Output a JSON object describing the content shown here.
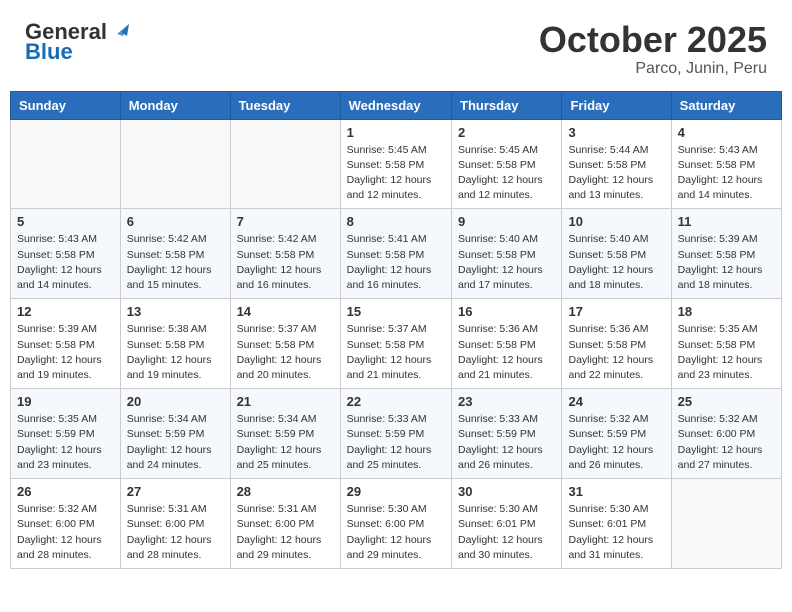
{
  "header": {
    "logo_line1": "General",
    "logo_line2": "Blue",
    "month": "October 2025",
    "location": "Parco, Junin, Peru"
  },
  "weekdays": [
    "Sunday",
    "Monday",
    "Tuesday",
    "Wednesday",
    "Thursday",
    "Friday",
    "Saturday"
  ],
  "weeks": [
    [
      {
        "day": "",
        "info": ""
      },
      {
        "day": "",
        "info": ""
      },
      {
        "day": "",
        "info": ""
      },
      {
        "day": "1",
        "info": "Sunrise: 5:45 AM\nSunset: 5:58 PM\nDaylight: 12 hours\nand 12 minutes."
      },
      {
        "day": "2",
        "info": "Sunrise: 5:45 AM\nSunset: 5:58 PM\nDaylight: 12 hours\nand 12 minutes."
      },
      {
        "day": "3",
        "info": "Sunrise: 5:44 AM\nSunset: 5:58 PM\nDaylight: 12 hours\nand 13 minutes."
      },
      {
        "day": "4",
        "info": "Sunrise: 5:43 AM\nSunset: 5:58 PM\nDaylight: 12 hours\nand 14 minutes."
      }
    ],
    [
      {
        "day": "5",
        "info": "Sunrise: 5:43 AM\nSunset: 5:58 PM\nDaylight: 12 hours\nand 14 minutes."
      },
      {
        "day": "6",
        "info": "Sunrise: 5:42 AM\nSunset: 5:58 PM\nDaylight: 12 hours\nand 15 minutes."
      },
      {
        "day": "7",
        "info": "Sunrise: 5:42 AM\nSunset: 5:58 PM\nDaylight: 12 hours\nand 16 minutes."
      },
      {
        "day": "8",
        "info": "Sunrise: 5:41 AM\nSunset: 5:58 PM\nDaylight: 12 hours\nand 16 minutes."
      },
      {
        "day": "9",
        "info": "Sunrise: 5:40 AM\nSunset: 5:58 PM\nDaylight: 12 hours\nand 17 minutes."
      },
      {
        "day": "10",
        "info": "Sunrise: 5:40 AM\nSunset: 5:58 PM\nDaylight: 12 hours\nand 18 minutes."
      },
      {
        "day": "11",
        "info": "Sunrise: 5:39 AM\nSunset: 5:58 PM\nDaylight: 12 hours\nand 18 minutes."
      }
    ],
    [
      {
        "day": "12",
        "info": "Sunrise: 5:39 AM\nSunset: 5:58 PM\nDaylight: 12 hours\nand 19 minutes."
      },
      {
        "day": "13",
        "info": "Sunrise: 5:38 AM\nSunset: 5:58 PM\nDaylight: 12 hours\nand 19 minutes."
      },
      {
        "day": "14",
        "info": "Sunrise: 5:37 AM\nSunset: 5:58 PM\nDaylight: 12 hours\nand 20 minutes."
      },
      {
        "day": "15",
        "info": "Sunrise: 5:37 AM\nSunset: 5:58 PM\nDaylight: 12 hours\nand 21 minutes."
      },
      {
        "day": "16",
        "info": "Sunrise: 5:36 AM\nSunset: 5:58 PM\nDaylight: 12 hours\nand 21 minutes."
      },
      {
        "day": "17",
        "info": "Sunrise: 5:36 AM\nSunset: 5:58 PM\nDaylight: 12 hours\nand 22 minutes."
      },
      {
        "day": "18",
        "info": "Sunrise: 5:35 AM\nSunset: 5:58 PM\nDaylight: 12 hours\nand 23 minutes."
      }
    ],
    [
      {
        "day": "19",
        "info": "Sunrise: 5:35 AM\nSunset: 5:59 PM\nDaylight: 12 hours\nand 23 minutes."
      },
      {
        "day": "20",
        "info": "Sunrise: 5:34 AM\nSunset: 5:59 PM\nDaylight: 12 hours\nand 24 minutes."
      },
      {
        "day": "21",
        "info": "Sunrise: 5:34 AM\nSunset: 5:59 PM\nDaylight: 12 hours\nand 25 minutes."
      },
      {
        "day": "22",
        "info": "Sunrise: 5:33 AM\nSunset: 5:59 PM\nDaylight: 12 hours\nand 25 minutes."
      },
      {
        "day": "23",
        "info": "Sunrise: 5:33 AM\nSunset: 5:59 PM\nDaylight: 12 hours\nand 26 minutes."
      },
      {
        "day": "24",
        "info": "Sunrise: 5:32 AM\nSunset: 5:59 PM\nDaylight: 12 hours\nand 26 minutes."
      },
      {
        "day": "25",
        "info": "Sunrise: 5:32 AM\nSunset: 6:00 PM\nDaylight: 12 hours\nand 27 minutes."
      }
    ],
    [
      {
        "day": "26",
        "info": "Sunrise: 5:32 AM\nSunset: 6:00 PM\nDaylight: 12 hours\nand 28 minutes."
      },
      {
        "day": "27",
        "info": "Sunrise: 5:31 AM\nSunset: 6:00 PM\nDaylight: 12 hours\nand 28 minutes."
      },
      {
        "day": "28",
        "info": "Sunrise: 5:31 AM\nSunset: 6:00 PM\nDaylight: 12 hours\nand 29 minutes."
      },
      {
        "day": "29",
        "info": "Sunrise: 5:30 AM\nSunset: 6:00 PM\nDaylight: 12 hours\nand 29 minutes."
      },
      {
        "day": "30",
        "info": "Sunrise: 5:30 AM\nSunset: 6:01 PM\nDaylight: 12 hours\nand 30 minutes."
      },
      {
        "day": "31",
        "info": "Sunrise: 5:30 AM\nSunset: 6:01 PM\nDaylight: 12 hours\nand 31 minutes."
      },
      {
        "day": "",
        "info": ""
      }
    ]
  ]
}
